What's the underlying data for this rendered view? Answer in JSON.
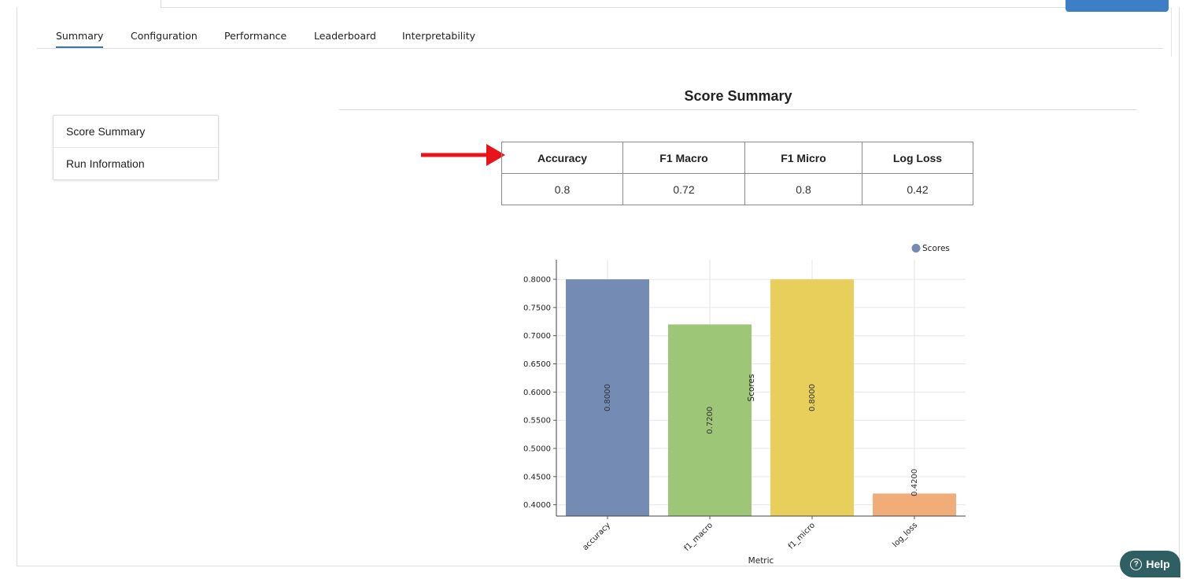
{
  "tabs": [
    {
      "label": "Summary",
      "active": true
    },
    {
      "label": "Configuration"
    },
    {
      "label": "Performance"
    },
    {
      "label": "Leaderboard"
    },
    {
      "label": "Interpretability"
    }
  ],
  "sidenav": {
    "items": [
      {
        "label": "Score Summary"
      },
      {
        "label": "Run Information"
      }
    ]
  },
  "section": {
    "title": "Score Summary"
  },
  "score_table": {
    "headers": [
      "Accuracy",
      "F1 Macro",
      "F1 Micro",
      "Log Loss"
    ],
    "values": [
      "0.8",
      "0.72",
      "0.8",
      "0.42"
    ]
  },
  "annotation": {
    "color": "#e8141a",
    "icon": "arrow-right-icon"
  },
  "chart_data": {
    "type": "bar",
    "categories": [
      "accuracy",
      "f1_macro",
      "f1_micro",
      "log_loss"
    ],
    "series": [
      {
        "name": "Scores",
        "values": [
          0.8,
          0.72,
          0.8,
          0.42
        ],
        "labels": [
          "0.8000",
          "0.7200",
          "0.8000",
          "0.4200"
        ],
        "colors": [
          "#748bb3",
          "#9dc677",
          "#e8cf5c",
          "#f0ad7a"
        ]
      }
    ],
    "xlabel": "Metric",
    "ylabel": "Scores",
    "ylim": [
      0.38,
      0.835
    ],
    "yticks": [
      "0.4000",
      "0.4500",
      "0.5000",
      "0.5500",
      "0.6000",
      "0.6500",
      "0.7000",
      "0.7500",
      "0.8000"
    ],
    "legend": {
      "label": "Scores",
      "position": "top-right",
      "color": "#748bb3"
    },
    "grid": true
  },
  "help": {
    "label": "Help",
    "icon": "question-circle-icon"
  }
}
